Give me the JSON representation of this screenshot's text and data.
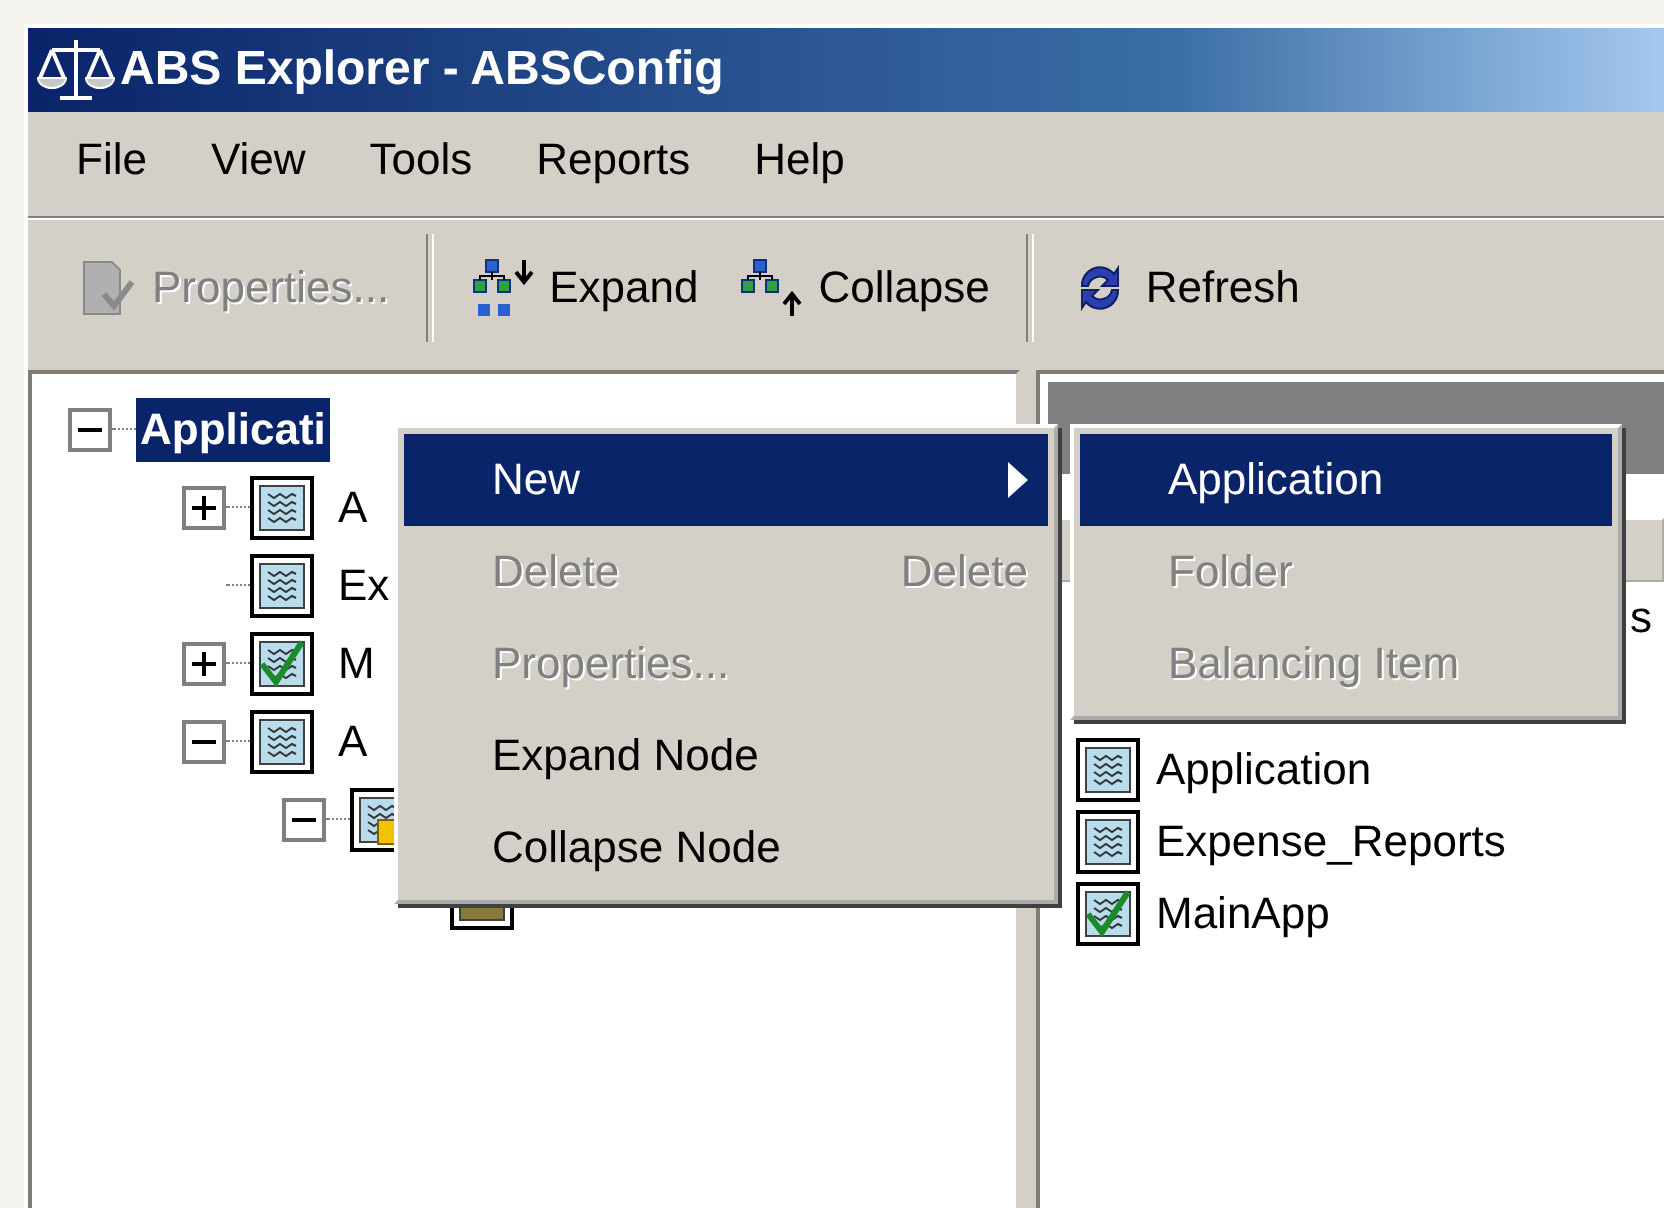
{
  "window": {
    "title": "ABS Explorer - ABSConfig"
  },
  "menu_bar": [
    "File",
    "View",
    "Tools",
    "Reports",
    "Help"
  ],
  "toolbar": [
    {
      "kind": "properties",
      "label": "Properties...",
      "disabled": true
    },
    {
      "kind": "expand",
      "label": "Expand",
      "disabled": false
    },
    {
      "kind": "collapse",
      "label": "Collapse",
      "disabled": false
    },
    {
      "kind": "refresh",
      "label": "Refresh",
      "disabled": false
    }
  ],
  "tree": {
    "label": "Applicati",
    "selected": true,
    "expanded": true,
    "children": [
      {
        "label": "A",
        "kind": "app",
        "expanded": false
      },
      {
        "label": "Ex",
        "kind": "app"
      },
      {
        "label": "M",
        "kind": "app-checked",
        "expanded": false
      },
      {
        "label": "A",
        "kind": "app",
        "expanded": true,
        "children": [
          {
            "kind": "folder",
            "expanded": true,
            "children": [
              {
                "kind": "rule"
              }
            ]
          }
        ]
      }
    ]
  },
  "list": [
    {
      "label": "s",
      "kind": "partial"
    },
    {
      "label": "Application",
      "kind": "app"
    },
    {
      "label": "Expense_Reports",
      "kind": "app"
    },
    {
      "label": "MainApp",
      "kind": "app-checked"
    }
  ],
  "context_menu": [
    {
      "label": "New",
      "submenu": true,
      "selected": true,
      "disabled": false
    },
    {
      "label": "Delete",
      "shortcut": "Delete",
      "submenu": false,
      "selected": false,
      "disabled": true
    },
    {
      "label": "Properties...",
      "submenu": false,
      "selected": false,
      "disabled": true
    },
    {
      "label": "Expand Node",
      "submenu": false,
      "selected": false,
      "disabled": false
    },
    {
      "label": "Collapse Node",
      "submenu": false,
      "selected": false,
      "disabled": false
    }
  ],
  "submenu": [
    {
      "label": "Application",
      "selected": true,
      "disabled": false
    },
    {
      "label": "Folder",
      "selected": false,
      "disabled": true
    },
    {
      "label": "Balancing Item",
      "selected": false,
      "disabled": true
    }
  ]
}
